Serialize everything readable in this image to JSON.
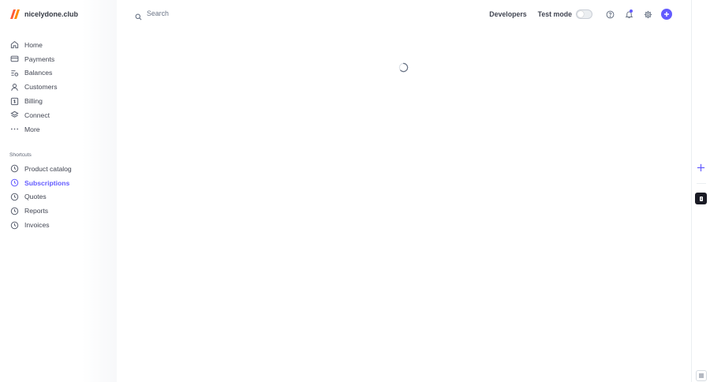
{
  "brand": {
    "name": "nicelydone.club",
    "accent": "#635bff",
    "logo_colors": [
      "#ff5c35",
      "#ff8a00"
    ]
  },
  "search": {
    "placeholder": "Search"
  },
  "topbar": {
    "developers_label": "Developers",
    "test_mode_label": "Test mode",
    "test_mode_on": false,
    "icons": [
      "help-icon",
      "bell-icon",
      "gear-icon",
      "plus-icon"
    ]
  },
  "nav": {
    "items": [
      {
        "label": "Home",
        "icon": "home-icon"
      },
      {
        "label": "Payments",
        "icon": "payments-icon"
      },
      {
        "label": "Balances",
        "icon": "balances-icon"
      },
      {
        "label": "Customers",
        "icon": "customers-icon"
      },
      {
        "label": "Billing",
        "icon": "billing-icon"
      },
      {
        "label": "Connect",
        "icon": "connect-icon"
      },
      {
        "label": "More",
        "icon": "more-icon"
      }
    ]
  },
  "shortcuts": {
    "title": "Shortcuts",
    "items": [
      {
        "label": "Product catalog",
        "icon": "clock-icon",
        "active": false
      },
      {
        "label": "Subscriptions",
        "icon": "clock-icon",
        "active": true
      },
      {
        "label": "Quotes",
        "icon": "clock-icon",
        "active": false
      },
      {
        "label": "Reports",
        "icon": "clock-icon",
        "active": false
      },
      {
        "label": "Invoices",
        "icon": "clock-icon",
        "active": false
      }
    ]
  },
  "main": {
    "loading": true
  },
  "right_rail": {
    "icons": [
      "plus-icon",
      "app-icon",
      "menu-icon"
    ]
  }
}
